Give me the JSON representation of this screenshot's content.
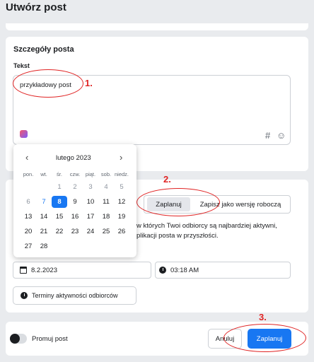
{
  "page": {
    "title": "Utwórz post"
  },
  "details": {
    "section_title": "Szczegóły posta",
    "text_label": "Tekst",
    "text_value": "przykładowy post"
  },
  "schedule": {
    "tab_schedule": "Zaplanuj",
    "tab_draft": "Zapisz jako wersję roboczą",
    "desc_line1": "w których Twoi odbiorcy są najbardziej aktywni,",
    "desc_line2": "plikacji posta w przyszłości.",
    "date_value": "8.2.2023",
    "time_value": "03:18 AM",
    "activity_button": "Terminy aktywności odbiorców"
  },
  "calendar": {
    "month": "lutego 2023",
    "weekdays": [
      "pon.",
      "wt.",
      "śr.",
      "czw.",
      "piąt.",
      "sob.",
      "niedz."
    ],
    "rows": [
      [
        "",
        "",
        "1",
        "2",
        "3",
        "4",
        "5"
      ],
      [
        "6",
        "7",
        "8",
        "9",
        "10",
        "11",
        "12"
      ],
      [
        "13",
        "14",
        "15",
        "16",
        "17",
        "18",
        "19"
      ],
      [
        "20",
        "21",
        "22",
        "23",
        "24",
        "25",
        "26"
      ],
      [
        "27",
        "28",
        "",
        "",
        "",
        "",
        ""
      ]
    ],
    "selected": "8",
    "today": "7",
    "muted": [
      "1",
      "2",
      "3",
      "4",
      "5",
      "6"
    ]
  },
  "footer": {
    "promote_label": "Promuj post",
    "cancel_label": "Anuluj",
    "schedule_label": "Zaplanuj"
  },
  "annotations": [
    "1.",
    "2.",
    "3."
  ],
  "colors": {
    "accent": "#1877f2",
    "annotation": "#e02424"
  }
}
